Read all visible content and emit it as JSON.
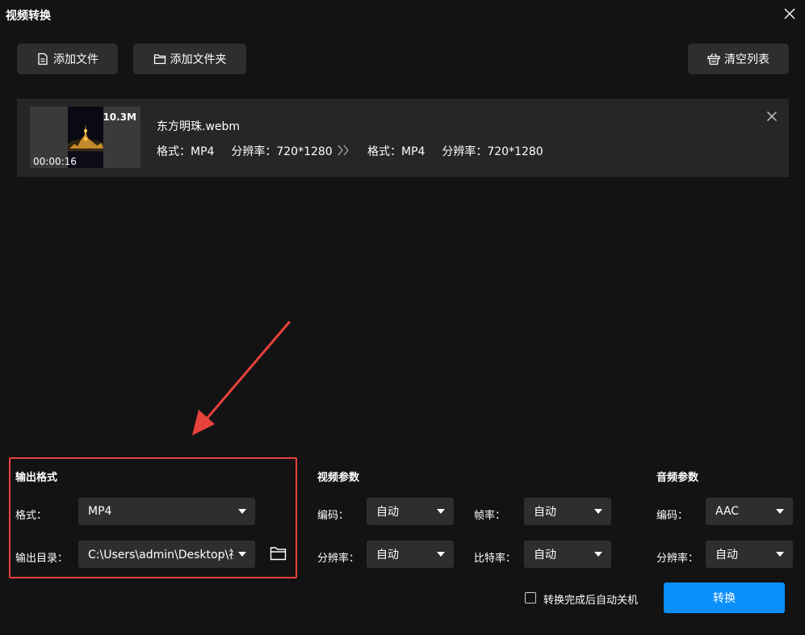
{
  "window": {
    "title": "视频转换",
    "close_icon": "close-icon"
  },
  "toolbar": {
    "add_file": {
      "label": "添加文件",
      "icon": "file-icon"
    },
    "add_folder": {
      "label": "添加文件夹",
      "icon": "folder-icon"
    },
    "clear_list": {
      "label": "清空列表",
      "icon": "basket-icon"
    }
  },
  "file": {
    "name": "东方明珠.webm",
    "size": "10.3M",
    "duration": "00:00:16",
    "source": {
      "format_label": "格式：",
      "format": "MP4",
      "resolution_label": "分辨率：",
      "resolution": "720*1280"
    },
    "target": {
      "format_label": "格式：",
      "format": "MP4",
      "resolution_label": "分辨率：",
      "resolution": "720*1280"
    }
  },
  "output": {
    "title": "输出格式",
    "format_label": "格式：",
    "format_value": "MP4",
    "dir_label": "输出目录：",
    "dir_value": "C:\\Users\\admin\\Desktop\\视频"
  },
  "video_params": {
    "title": "视频参数",
    "codec_label": "编码：",
    "codec_value": "自动",
    "fps_label": "帧率：",
    "fps_value": "自动",
    "resolution_label": "分辨率：",
    "resolution_value": "自动",
    "bitrate_label": "比特率：",
    "bitrate_value": "自动"
  },
  "audio_params": {
    "title": "音频参数",
    "codec_label": "编码：",
    "codec_value": "AAC",
    "resolution_label": "分辨率：",
    "resolution_value": "自动"
  },
  "footer": {
    "shutdown_label": "转换完成后自动关机",
    "convert_label": "转换"
  },
  "colors": {
    "background": "#131313",
    "button": "#2e2e2e",
    "card": "#262626",
    "accent": "#0a8ffb",
    "highlight": "#e8423c"
  }
}
